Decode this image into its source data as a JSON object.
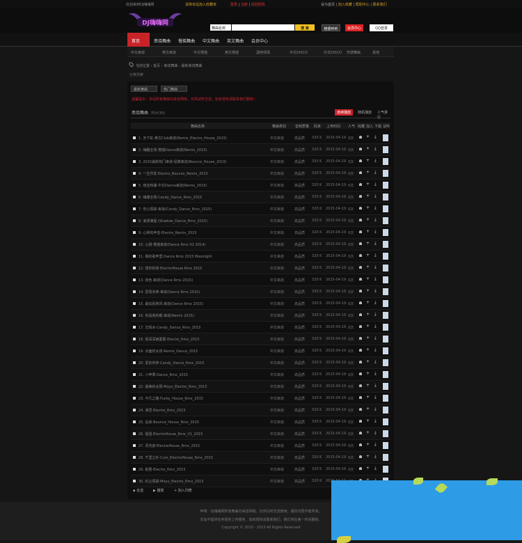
{
  "topbar": {
    "welcome": "欢迎来到DJ嗨嗨网",
    "notice": "请将本站加入收藏夹",
    "links": [
      "登录",
      "注册",
      "找回密码"
    ],
    "right": [
      "设为首页",
      "加入收藏",
      "帮助中心",
      "联系我们"
    ]
  },
  "header": {
    "logo_text": "DJ嗨嗨网",
    "search_select": "舞曲名称",
    "search_placeholder": "",
    "search_button": "搜 索",
    "btn_play": "随便听听",
    "btn_upload": "会员中心",
    "btn_qq": "QQ登录"
  },
  "nav": {
    "items": [
      "首页",
      "串烧舞曲",
      "慢摇舞曲",
      "中文舞曲",
      "英文舞曲",
      "会员中心"
    ]
  },
  "subnav": {
    "items": [
      "中文串烧",
      "英文串烧",
      "中文慢摇",
      "英文慢摇",
      "酒吧现场",
      "中文DISCO",
      "外文DISCO",
      "伤感舞曲",
      "其他"
    ]
  },
  "breadcrumb": "当前位置 › 首页 › 串烧舞曲 › 最新串烧舞曲",
  "small_text": "分类列表",
  "tabs": [
    "最新舞曲",
    "热门舞曲"
  ],
  "notice": "温馨提示：本站所有舞曲均来自网络，仅供试听交流，如有侵权请联系我们删除！",
  "list": {
    "title": "串烧舞曲",
    "count": "共计(30)",
    "buttons": [
      "连续播放",
      "随机播放",
      "人气排行"
    ]
  },
  "columns": [
    "舞曲名称",
    "舞曲类别",
    "音频质量",
    "码率",
    "上传时间",
    "人气",
    "收藏",
    "加入",
    "下载",
    "试听"
  ],
  "rows": [
    {
      "name": "1. 天下彩·英文Club串烧(Remix_Electro_House_2015)",
      "cat": "中文串烧",
      "q": "高品质",
      "kbps": "320 K",
      "date": "2015-04-19",
      "hot": "0次"
    },
    {
      "name": "2. 嗨翻全场·慢摇Dance串烧(Remix_2015)",
      "cat": "中文串烧",
      "q": "高品质",
      "kbps": "320 K",
      "date": "2015-04-19",
      "hot": "0次"
    },
    {
      "name": "3. 2015最新热门串烧·经典串烧(Bounce_House_2015)",
      "cat": "中文串烧",
      "q": "高品质",
      "kbps": "320 K",
      "date": "2015-04-19",
      "hot": "0次"
    },
    {
      "name": "4. 一生所爱·Electro_Bounce_Remix_2015",
      "cat": "中文串烧",
      "q": "高品质",
      "kbps": "320 K",
      "date": "2015-04-19",
      "hot": "0次"
    },
    {
      "name": "5. 夜店热播·中文Dance串烧(Remix_2015)",
      "cat": "中文串烧",
      "q": "高品质",
      "kbps": "320 K",
      "date": "2015-04-19",
      "hot": "0次"
    },
    {
      "name": "6. 嗨爆全场·Candy_Dance_Rmx_2015",
      "cat": "中文串烧",
      "q": "高品质",
      "kbps": "320 K",
      "date": "2015-04-19",
      "hot": "0次"
    },
    {
      "name": "7. 伤心情歌·串烧(Candy_Dance_Rmx_2015)",
      "cat": "中文串烧",
      "q": "高品质",
      "kbps": "320 K",
      "date": "2015-04-19",
      "hot": "0次"
    },
    {
      "name": "8. 浪漫满屋·(Shadow_Dance_Rmx_2015)",
      "cat": "中文串烧",
      "q": "高品质",
      "kbps": "320 K",
      "date": "2015-04-19",
      "hot": "0次"
    },
    {
      "name": "9. 心碎的声音·Electro_Remix_2015",
      "cat": "中文串烧",
      "q": "高品质",
      "kbps": "320 K",
      "date": "2015-04-19",
      "hot": "0次"
    },
    {
      "name": "10. 心跳·慢摇串烧(Dance Rmx V2 2014)",
      "cat": "中文串烧",
      "q": "高品质",
      "kbps": "320 K",
      "date": "2015-04-19",
      "hot": "0次"
    },
    {
      "name": "11. 我的歌声里·Dance Rmx 2015 Moonlight",
      "cat": "中文串烧",
      "q": "高品质",
      "kbps": "320 K",
      "date": "2015-04-19",
      "hot": "0次"
    },
    {
      "name": "12. 想你的夜·ElectroHouse Rmx 2015",
      "cat": "中文串烧",
      "q": "高品质",
      "kbps": "320 K",
      "date": "2015-04-19",
      "hot": "0次"
    },
    {
      "name": "13. 夜色·串烧(Dance Rmx 2015)",
      "cat": "中文串烧",
      "q": "高品质",
      "kbps": "320 K",
      "date": "2015-04-19",
      "hot": "0次"
    },
    {
      "name": "14. 爱情买卖·串烧(Dance Rmx 2015)",
      "cat": "中文串烧",
      "q": "高品质",
      "kbps": "320 K",
      "date": "2015-04-19",
      "hot": "0次"
    },
    {
      "name": "15. 最炫民族风·串烧(Dance Rmx 2015)",
      "cat": "中文串烧",
      "q": "高品质",
      "kbps": "320 K",
      "date": "2015-04-19",
      "hot": "0次"
    },
    {
      "name": "16. 你是我的眼·串烧(Remix 2015)",
      "cat": "中文串烧",
      "q": "高品质",
      "kbps": "320 K",
      "date": "2015-04-19",
      "hot": "0次"
    },
    {
      "name": "17. 忘情水·Candy_Dance_Rmx_2015",
      "cat": "中文串烧",
      "q": "高品质",
      "kbps": "320 K",
      "date": "2015-04-19",
      "hot": "0次"
    },
    {
      "name": "18. 情深深雨蒙蒙·Electro_Rmx_2015",
      "cat": "中文串烧",
      "q": "高品质",
      "kbps": "320 K",
      "date": "2015-04-19",
      "hot": "0次"
    },
    {
      "name": "19. 对面的女孩·Remix_Dance_2015",
      "cat": "中文串烧",
      "q": "高品质",
      "kbps": "320 K",
      "date": "2015-04-19",
      "hot": "0次"
    },
    {
      "name": "20. 爱的供养·Candy_Dance_Rmx_2015",
      "cat": "中文串烧",
      "q": "高品质",
      "kbps": "320 K",
      "date": "2015-04-19",
      "hot": "0次"
    },
    {
      "name": "21. 小苹果·Dance_Rmx_2015",
      "cat": "中文串烧",
      "q": "高品质",
      "kbps": "320 K",
      "date": "2015-04-19",
      "hot": "0次"
    },
    {
      "name": "22. 最美的太阳·Moyu_Electro_Rmx_2015",
      "cat": "中文串烧",
      "q": "高品质",
      "kbps": "320 K",
      "date": "2015-04-19",
      "hot": "0次"
    },
    {
      "name": "23. 平凡之路·Funky_House_Rmx_2015",
      "cat": "中文串烧",
      "q": "高品质",
      "kbps": "320 K",
      "date": "2015-04-19",
      "hot": "0次"
    },
    {
      "name": "24. 演员·Electro_Rmx_2015",
      "cat": "中文串烧",
      "q": "高品质",
      "kbps": "320 K",
      "date": "2015-04-19",
      "hot": "0次"
    },
    {
      "name": "25. 后来·Bounce_House_Rmx_2015",
      "cat": "中文串烧",
      "q": "高品质",
      "kbps": "320 K",
      "date": "2015-04-19",
      "hot": "0次"
    },
    {
      "name": "26. 倔强·ElectroHouse_Rmx_V1_2015",
      "cat": "中文串烧",
      "q": "高品质",
      "kbps": "320 K",
      "date": "2015-04-19",
      "hot": "0次"
    },
    {
      "name": "27. 青花瓷·ElectroHouse_Rmx_2015",
      "cat": "中文串烧",
      "q": "高品质",
      "kbps": "320 K",
      "date": "2015-04-19",
      "hot": "0次"
    },
    {
      "name": "28. 千里之外·Cum_ElectroHouse_Rmx_2015",
      "cat": "中文串烧",
      "q": "高品质",
      "kbps": "320 K",
      "date": "2015-04-19",
      "hot": "0次"
    },
    {
      "name": "29. 稻香·Electro_Rmx_2015",
      "cat": "中文串烧",
      "q": "高品质",
      "kbps": "320 K",
      "date": "2015-04-19",
      "hot": "0次"
    },
    {
      "name": "30. 红尘情歌·Moyu_Electro_Rmx_2015",
      "cat": "中文串烧",
      "q": "高品质",
      "kbps": "320 K",
      "date": "2015-04-19",
      "hot": "0次"
    }
  ],
  "list_footer": [
    "全选",
    "播放",
    "加入列表"
  ],
  "footer": {
    "line1": "声明：DJ嗨嗨网所有舞曲均来自网络，仅供试听交流使用，版权归原作者所有。",
    "line2": "本站不提供任何视听上传服务，如有侵权请联系我们，我们将在第一时间删除。",
    "line3": "Copyright © 2010 - 2015 All Rights Reserved"
  }
}
